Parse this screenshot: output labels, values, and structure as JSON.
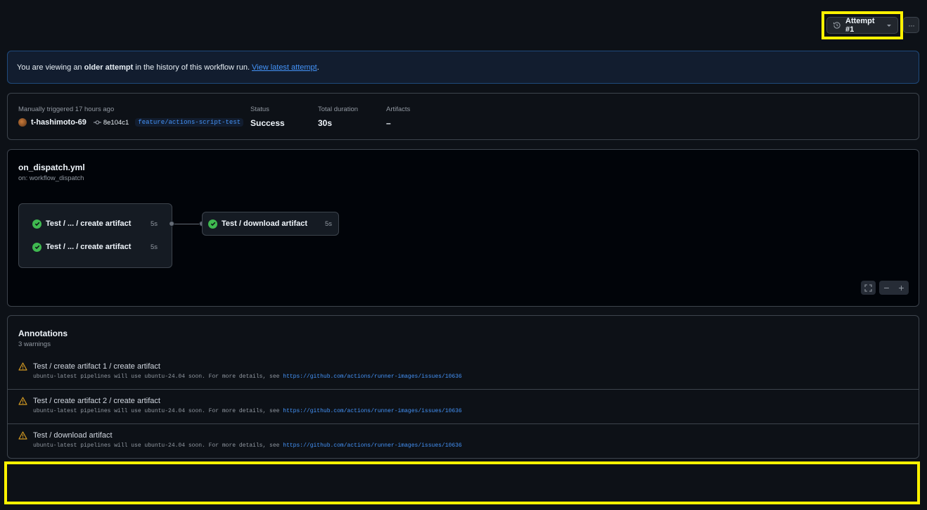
{
  "header": {
    "attempt_label": "Attempt #1",
    "more_label": "···"
  },
  "banner": {
    "prefix": "You are viewing an",
    "bold": "older attempt",
    "suffix": "in the history of this workflow run.",
    "link": "View latest attempt",
    "end": "."
  },
  "summary": {
    "trigger": "Manually triggered 17 hours ago",
    "user": "t-hashimoto-69",
    "commit": "8e104c1",
    "branch": "feature/actions-script-test",
    "stats": [
      {
        "label": "Status",
        "value": "Success"
      },
      {
        "label": "Total duration",
        "value": "30s"
      },
      {
        "label": "Artifacts",
        "value": "–"
      }
    ]
  },
  "workflow": {
    "file": "on_dispatch.yml",
    "trigger": "on: workflow_dispatch",
    "jobs": [
      {
        "name": "Test / ... / create artifact",
        "duration": "5s",
        "status": "success"
      },
      {
        "name": "Test / ... / create artifact",
        "duration": "5s",
        "status": "success"
      },
      {
        "name": "Test / download artifact",
        "duration": "5s",
        "status": "success"
      }
    ],
    "zoom_out": "−",
    "zoom_in": "+"
  },
  "annotations": {
    "title": "Annotations",
    "count": "3 warnings",
    "items": [
      {
        "title": "Test / create artifact 1 / create artifact",
        "message": "ubuntu-latest pipelines will use ubuntu-24.04 soon. For more details, see",
        "link": "https://github.com/actions/runner-images/issues/10636"
      },
      {
        "title": "Test / create artifact 2 / create artifact",
        "message": "ubuntu-latest pipelines will use ubuntu-24.04 soon. For more details, see",
        "link": "https://github.com/actions/runner-images/issues/10636"
      },
      {
        "title": "Test / download artifact",
        "message": "ubuntu-latest pipelines will use ubuntu-24.04 soon. For more details, see",
        "link": "https://github.com/actions/runner-images/issues/10636"
      }
    ]
  },
  "colors": {
    "success": "#3fb950",
    "warning": "#d29922",
    "link": "#4493f8",
    "highlight": "#fff200"
  }
}
